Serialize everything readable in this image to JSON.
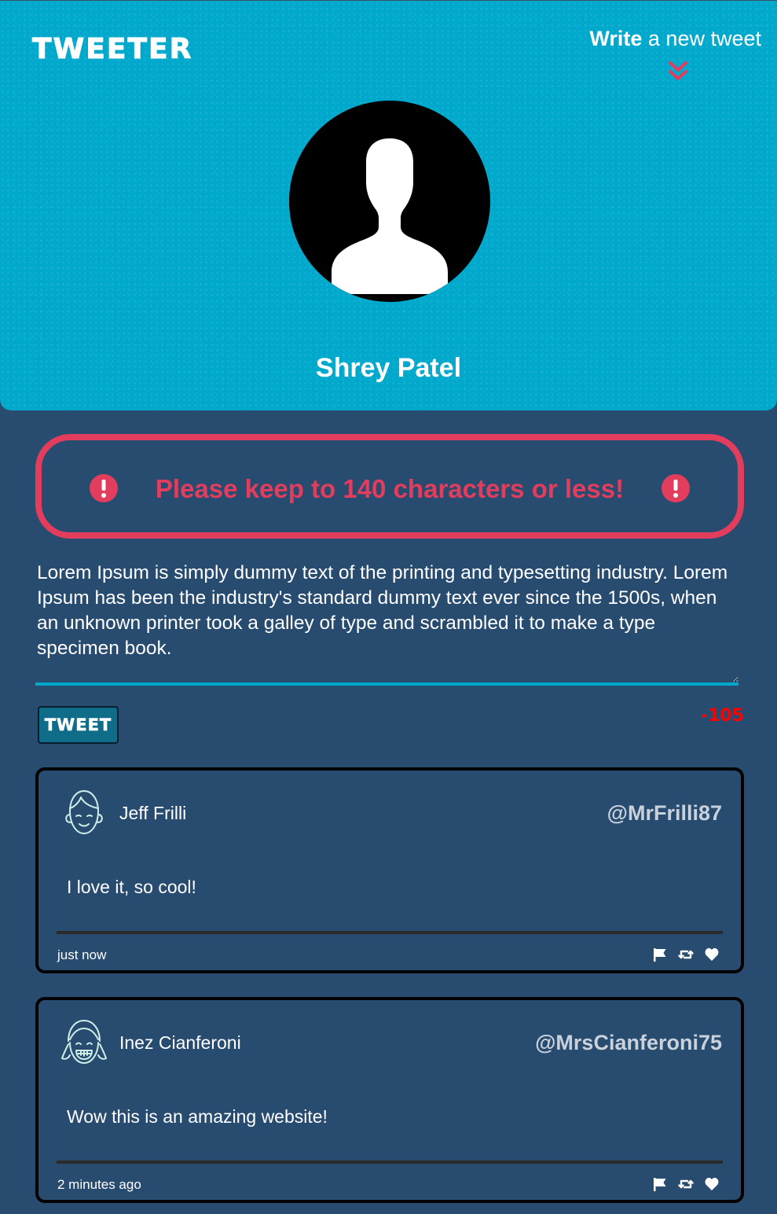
{
  "header": {
    "brand": "TWEETER",
    "compose_strong": "Write",
    "compose_rest": "a new tweet",
    "compose_icon": "double-chevron-down-icon",
    "profile_name": "Shrey Patel",
    "profile_avatar_icon": "user-silhouette-icon"
  },
  "error": {
    "message": "Please keep to 140 characters or less!",
    "icon": "exclamation-circle-icon"
  },
  "composer": {
    "value": "Lorem Ipsum is simply dummy text of the printing and typesetting industry. Lorem Ipsum has been the industry's standard dummy text ever since the 1500s, when an unknown printer took a galley of type and scrambled it to make a type specimen book.",
    "button_label": "TWEET",
    "counter": "-105"
  },
  "tweets": [
    {
      "avatar_icon": "boy-face-icon",
      "author": "Jeff Frilli",
      "handle": "@MrFrilli87",
      "body": "I love it, so cool!",
      "time": "just now",
      "actions": [
        "flag-icon",
        "retweet-icon",
        "heart-icon"
      ]
    },
    {
      "avatar_icon": "girl-face-icon",
      "author": "Inez Cianferoni",
      "handle": "@MrsCianferoni75",
      "body": "Wow this is an amazing website!",
      "time": "2 minutes ago",
      "actions": [
        "flag-icon",
        "retweet-icon",
        "heart-icon"
      ]
    }
  ],
  "colors": {
    "header_bg": "#00a8cc",
    "page_bg": "#284b70",
    "error": "#e23d5d",
    "counter": "#ff0000",
    "button_bg": "#0f6d8a"
  }
}
